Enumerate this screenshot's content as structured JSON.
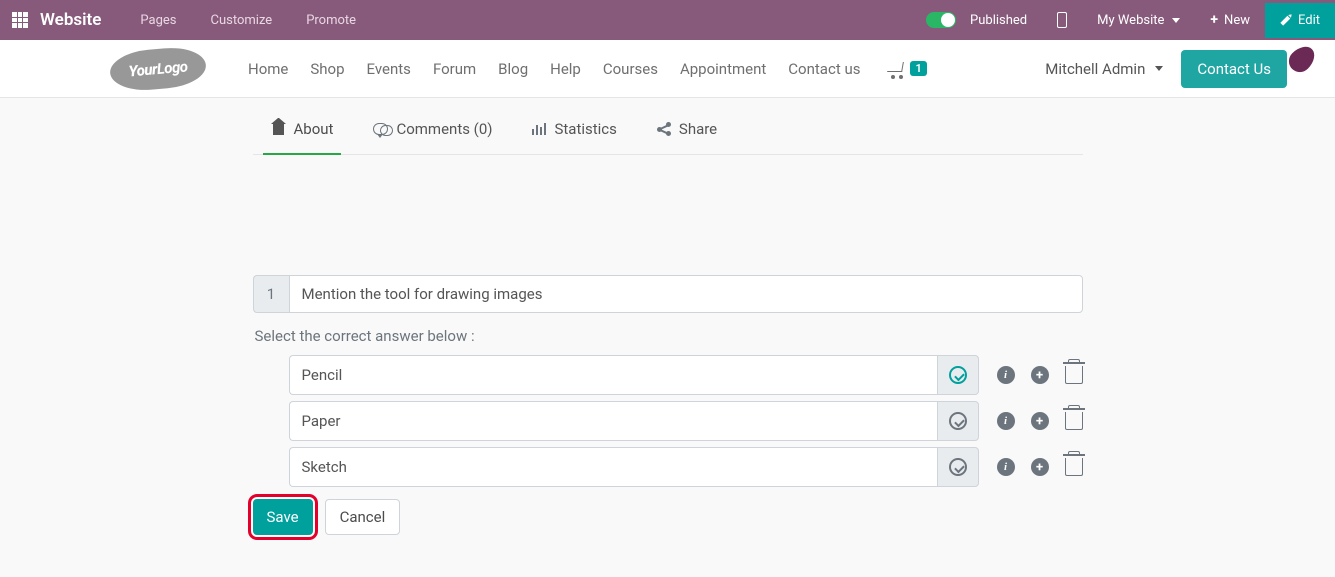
{
  "topbar": {
    "title": "Website",
    "menu": [
      "Pages",
      "Customize",
      "Promote"
    ],
    "published": "Published",
    "my_site": "My Website",
    "new": "New",
    "edit": "Edit"
  },
  "header": {
    "logo_primary": "Your",
    "logo_secondary": "Logo",
    "nav": [
      "Home",
      "Shop",
      "Events",
      "Forum",
      "Blog",
      "Help",
      "Courses",
      "Appointment",
      "Contact us"
    ],
    "cart_count": "1",
    "user": "Mitchell Admin",
    "contact": "Contact Us"
  },
  "tabs": {
    "about": "About",
    "comments": "Comments (0)",
    "statistics": "Statistics",
    "share": "Share"
  },
  "question": {
    "number": "1",
    "text": "Mention the tool for drawing images",
    "hint": "Select the correct answer below :",
    "answers": [
      "Pencil",
      "Paper",
      "Sketch"
    ],
    "correct_index": 0
  },
  "buttons": {
    "save": "Save",
    "cancel": "Cancel"
  }
}
